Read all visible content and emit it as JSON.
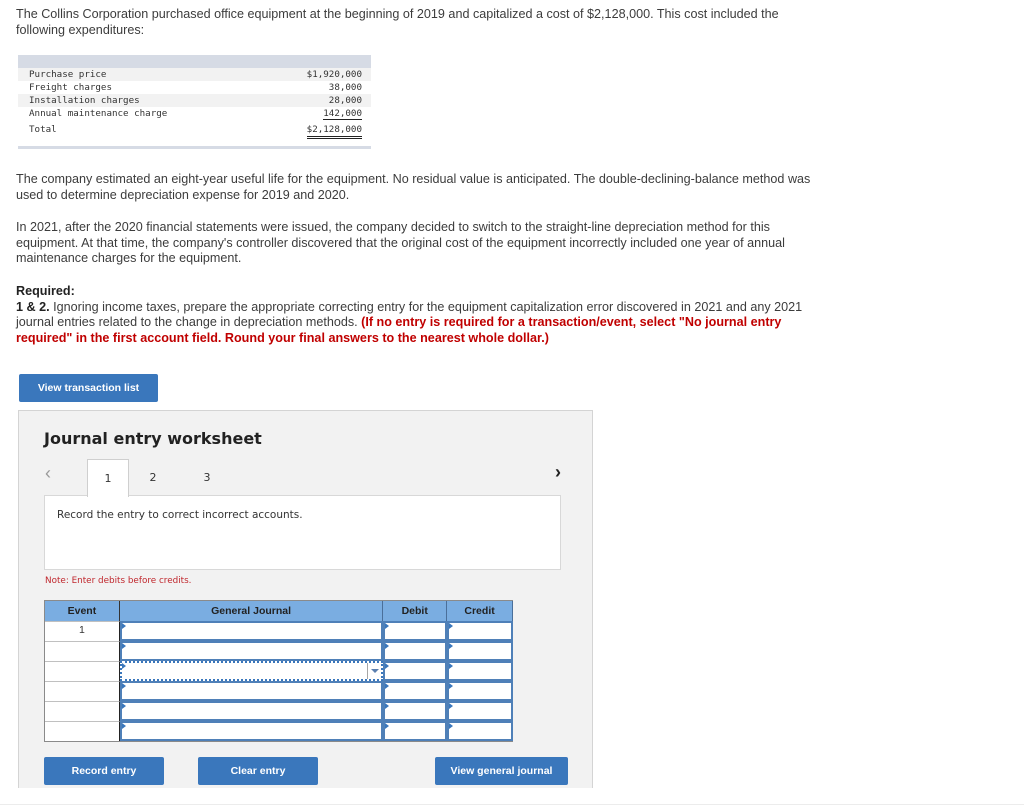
{
  "problem": {
    "intro": "The Collins Corporation purchased office equipment at the beginning of 2019 and capitalized a cost of $2,128,000. This cost included the following expenditures:",
    "cost_items": [
      {
        "label": "Purchase price",
        "amount": "$1,920,000"
      },
      {
        "label": "Freight charges",
        "amount": "38,000"
      },
      {
        "label": "Installation charges",
        "amount": "28,000"
      },
      {
        "label": "Annual maintenance charge",
        "amount": "142,000"
      }
    ],
    "cost_total": {
      "label": "Total",
      "amount": "$2,128,000"
    },
    "para2": "The company estimated an eight-year useful life for the equipment. No residual value is anticipated. The double-declining-balance method was used to determine depreciation expense for 2019 and 2020.",
    "para3": "In 2021, after the 2020 financial statements were issued, the company decided to switch to the straight-line depreciation method for this equipment. At that time, the company's controller discovered that the original cost of the equipment incorrectly included one year of annual maintenance charges for the equipment.",
    "required_heading": "Required:",
    "required_number": "1 & 2.",
    "required_text": " Ignoring income taxes, prepare the appropriate correcting entry for the equipment capitalization error discovered in 2021 and any 2021 journal entries related to the change in depreciation methods. ",
    "required_note": "(If no entry is required for a transaction/event, select \"No journal entry required\" in the first account field. Round your final answers to the nearest whole dollar.)"
  },
  "buttons": {
    "view_transaction_list": "View transaction list",
    "record_entry": "Record entry",
    "clear_entry": "Clear entry",
    "view_general_journal": "View general journal"
  },
  "worksheet": {
    "title": "Journal entry worksheet",
    "tabs": [
      "1",
      "2",
      "3"
    ],
    "active_tab": "1",
    "prev_icon": "chevron-left",
    "next_icon": "chevron-right",
    "instruction": "Record the entry to correct incorrect accounts.",
    "note": "Note: Enter debits before credits.",
    "table": {
      "headers": {
        "event": "Event",
        "general_journal": "General Journal",
        "debit": "Debit",
        "credit": "Credit"
      },
      "rows": [
        {
          "event": "1",
          "account": "",
          "debit": "",
          "credit": ""
        },
        {
          "event": "",
          "account": "",
          "debit": "",
          "credit": ""
        },
        {
          "event": "",
          "account": "",
          "debit": "",
          "credit": ""
        },
        {
          "event": "",
          "account": "",
          "debit": "",
          "credit": ""
        },
        {
          "event": "",
          "account": "",
          "debit": "",
          "credit": ""
        },
        {
          "event": "",
          "account": "",
          "debit": "",
          "credit": ""
        }
      ]
    }
  },
  "colors": {
    "button_blue": "#3a77bc",
    "header_blue": "#7aade1",
    "note_red": "#c0272d",
    "instruction_red": "#c00000"
  }
}
